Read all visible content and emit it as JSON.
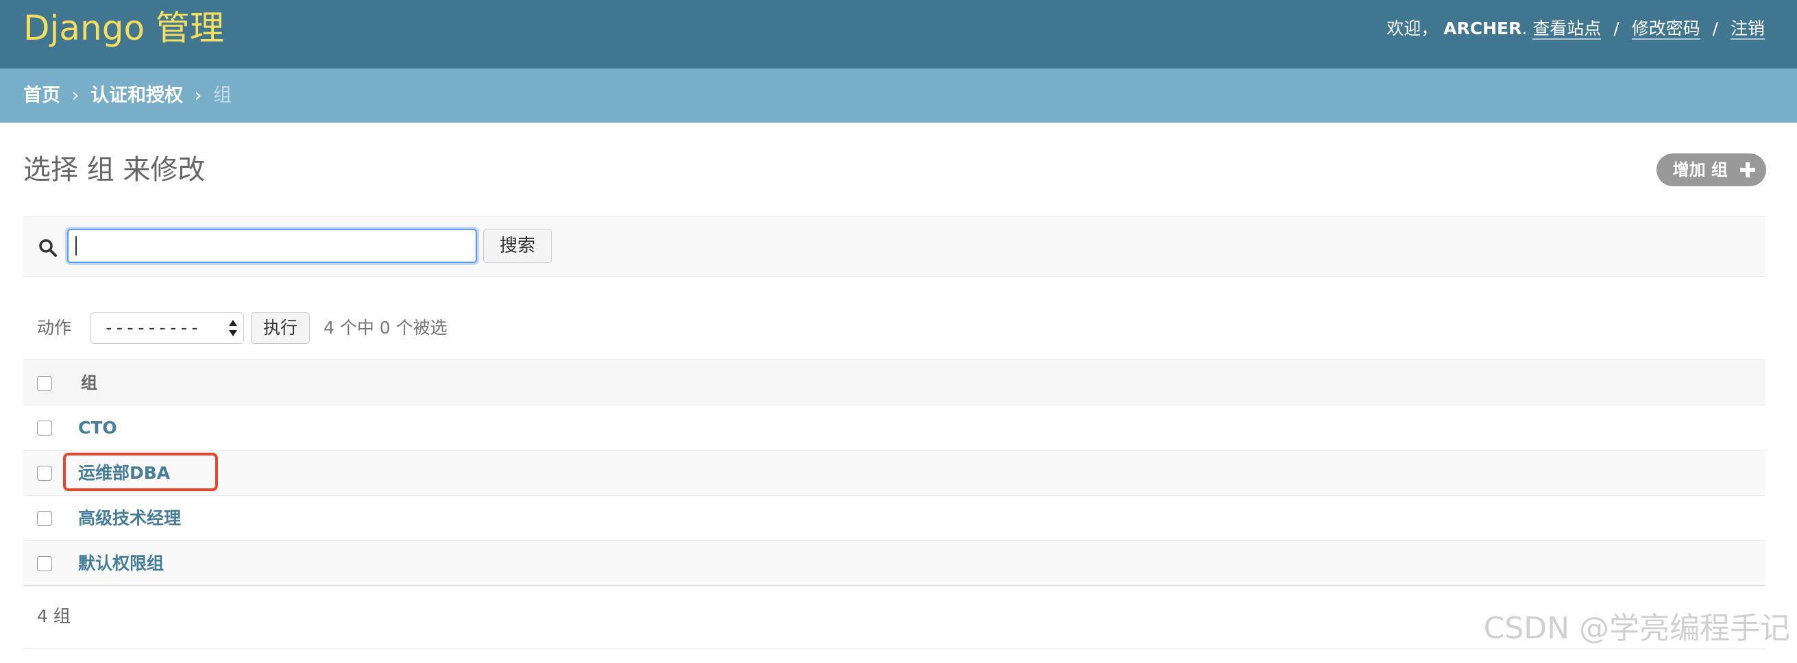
{
  "header": {
    "site_title": "Django 管理",
    "welcome": "欢迎，",
    "username": "ARCHER",
    "username_suffix": ".",
    "view_site": "查看站点",
    "change_password": "修改密码",
    "logout": "注销",
    "separator": "/"
  },
  "breadcrumbs": {
    "home": "首页",
    "app": "认证和授权",
    "current": "组",
    "arrow": "›"
  },
  "page": {
    "title": "选择 组 来修改",
    "add_button": "增加 组"
  },
  "search": {
    "value": "",
    "button": "搜索"
  },
  "actions": {
    "label": "动作",
    "selected_option": "---------",
    "go_button": "执行",
    "counter": "4 个中 0 个被选"
  },
  "table": {
    "column_header": "组",
    "rows": [
      "CTO",
      "运维部DBA",
      "高级技术经理",
      "默认权限组"
    ],
    "highlighted_row_index": 1
  },
  "paginator": "4 组",
  "watermark": "CSDN @学亮编程手记",
  "colors": {
    "header_bg": "#417690",
    "breadcrumb_bg": "#79aec8",
    "site_title": "#f5dd5d",
    "link": "#447e9b",
    "highlight": "#e8452c"
  }
}
